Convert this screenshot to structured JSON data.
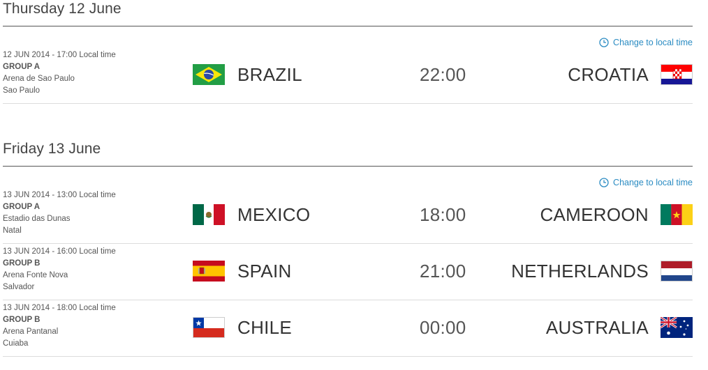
{
  "local_time_link": "Change to local time",
  "days": [
    {
      "title": "Thursday 12 June",
      "matches": [
        {
          "datetime": "12 JUN 2014 - 17:00 Local time",
          "group": "GROUP A",
          "stadium": "Arena de Sao Paulo",
          "city": "Sao Paulo",
          "home": "BRAZIL",
          "home_flag": "flag-brazil",
          "time": "22:00",
          "away": "CROATIA",
          "away_flag": "flag-croatia"
        }
      ]
    },
    {
      "title": "Friday 13 June",
      "matches": [
        {
          "datetime": "13 JUN 2014 - 13:00 Local time",
          "group": "GROUP A",
          "stadium": "Estadio das Dunas",
          "city": "Natal",
          "home": "MEXICO",
          "home_flag": "flag-mexico",
          "time": "18:00",
          "away": "CAMEROON",
          "away_flag": "flag-cameroon"
        },
        {
          "datetime": "13 JUN 2014 - 16:00 Local time",
          "group": "GROUP B",
          "stadium": "Arena Fonte Nova",
          "city": "Salvador",
          "home": "SPAIN",
          "home_flag": "flag-spain",
          "time": "21:00",
          "away": "NETHERLANDS",
          "away_flag": "flag-netherlands"
        },
        {
          "datetime": "13 JUN 2014 - 18:00 Local time",
          "group": "GROUP B",
          "stadium": "Arena Pantanal",
          "city": "Cuiaba",
          "home": "CHILE",
          "home_flag": "flag-chile",
          "time": "00:00",
          "away": "AUSTRALIA",
          "away_flag": "flag-australia"
        }
      ]
    }
  ],
  "colors": {
    "accent": "#2a8bc2",
    "text": "#444444",
    "rule": "#555555",
    "divider": "#dcdcdc"
  }
}
